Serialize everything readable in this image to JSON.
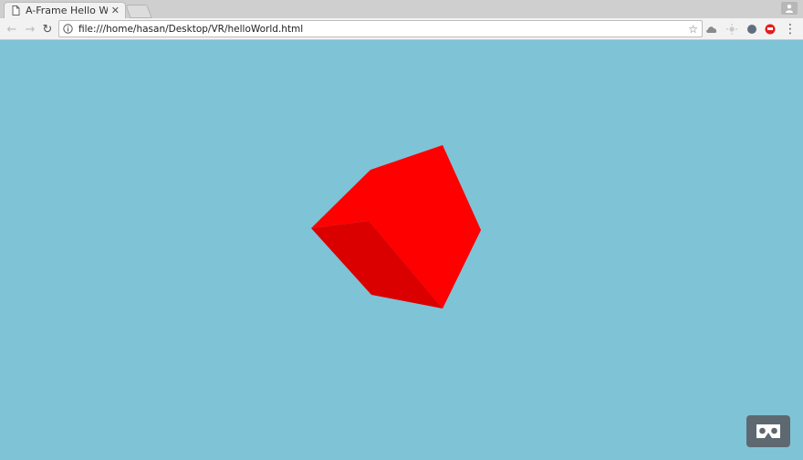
{
  "tab": {
    "title": "A-Frame Hello World",
    "close_glyph": "✕",
    "favicon": "page-icon"
  },
  "toolbar": {
    "back_glyph": "←",
    "forward_glyph": "→",
    "reload_glyph": "↻",
    "url": "file:///home/hasan/Desktop/VR/helloWorld.html",
    "star_glyph": "☆",
    "menu_glyph": "⋮"
  },
  "extensions": [
    "cloud-extension-icon",
    "sun-extension-icon",
    "shield-extension-icon",
    "chat-extension-icon"
  ],
  "scene": {
    "background_color": "#7fc3d7",
    "cube_color": "#ff0000",
    "cube_shadow_color": "#db0000"
  },
  "colors": {
    "tabstrip": "#cfcfcf",
    "toolbar": "#f2f2f2",
    "vr_button": "#5e6870"
  }
}
